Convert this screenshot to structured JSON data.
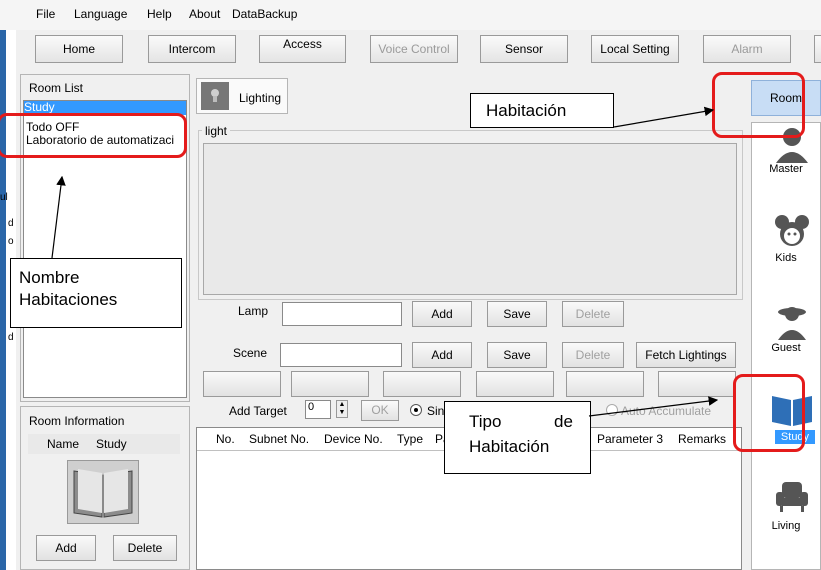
{
  "menu": [
    "File",
    "Language",
    "Help",
    "About",
    "DataBackup"
  ],
  "toolbar": {
    "home": "Home",
    "intercom": "Intercom",
    "access": "Access",
    "voice": "Voice Control",
    "sensor": "Sensor",
    "local": "Local Setting",
    "alarm": "Alarm"
  },
  "room_list": {
    "title": "Room List",
    "items": [
      "Study",
      "Todo OFF",
      "Laboratorio de automatizaci"
    ]
  },
  "lighting_tab": "Lighting",
  "light_group": "light",
  "lamp": {
    "label": "Lamp",
    "add": "Add",
    "save": "Save",
    "delete": "Delete"
  },
  "scene": {
    "label": "Scene",
    "add": "Add",
    "save": "Save",
    "delete": "Delete",
    "fetch": "Fetch Lightings"
  },
  "target": {
    "label": "Add Target",
    "value": "0",
    "ok": "OK",
    "single": "Sin",
    "auto": "Auto Accumulate"
  },
  "table_headers": [
    "No.",
    "Subnet No.",
    "Device No.",
    "Type",
    "Pa",
    "Parameter 3",
    "Remarks"
  ],
  "room_info": {
    "title": "Room Information",
    "name_label": "Name",
    "name_value": "Study",
    "add": "Add",
    "delete": "Delete"
  },
  "sidebar": {
    "room": "Room",
    "items": [
      "Master",
      "Kids",
      "Guest",
      "Study",
      "Living"
    ]
  },
  "callouts": {
    "habitacion": "Habitación",
    "nombre": "Nombre\nHabitaciones",
    "tipo_1": "Tipo",
    "tipo_de": "de",
    "tipo_2": "Habitación"
  },
  "left_edge_letters": [
    "ul",
    "d",
    "o",
    "d"
  ]
}
